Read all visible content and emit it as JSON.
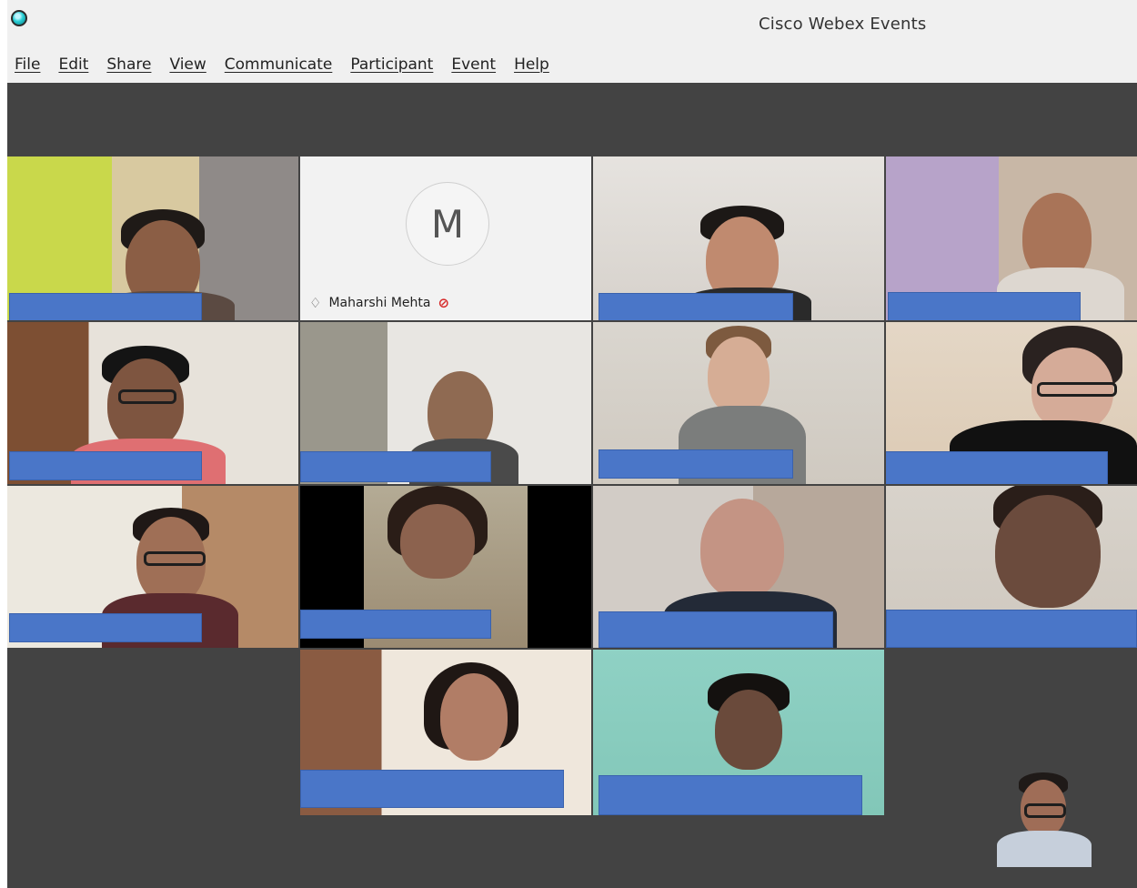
{
  "window": {
    "title": "Cisco Webex Events"
  },
  "menu": [
    "File",
    "Edit",
    "Share",
    "View",
    "Communicate",
    "Participant",
    "Event",
    "Help"
  ],
  "participants": {
    "avatar_initial": "M",
    "named_participant": "Maharshi Mehta"
  },
  "colors": {
    "stage_bg": "#434343",
    "name_redaction": "#4a76c8",
    "muted": "#d62a2a"
  }
}
